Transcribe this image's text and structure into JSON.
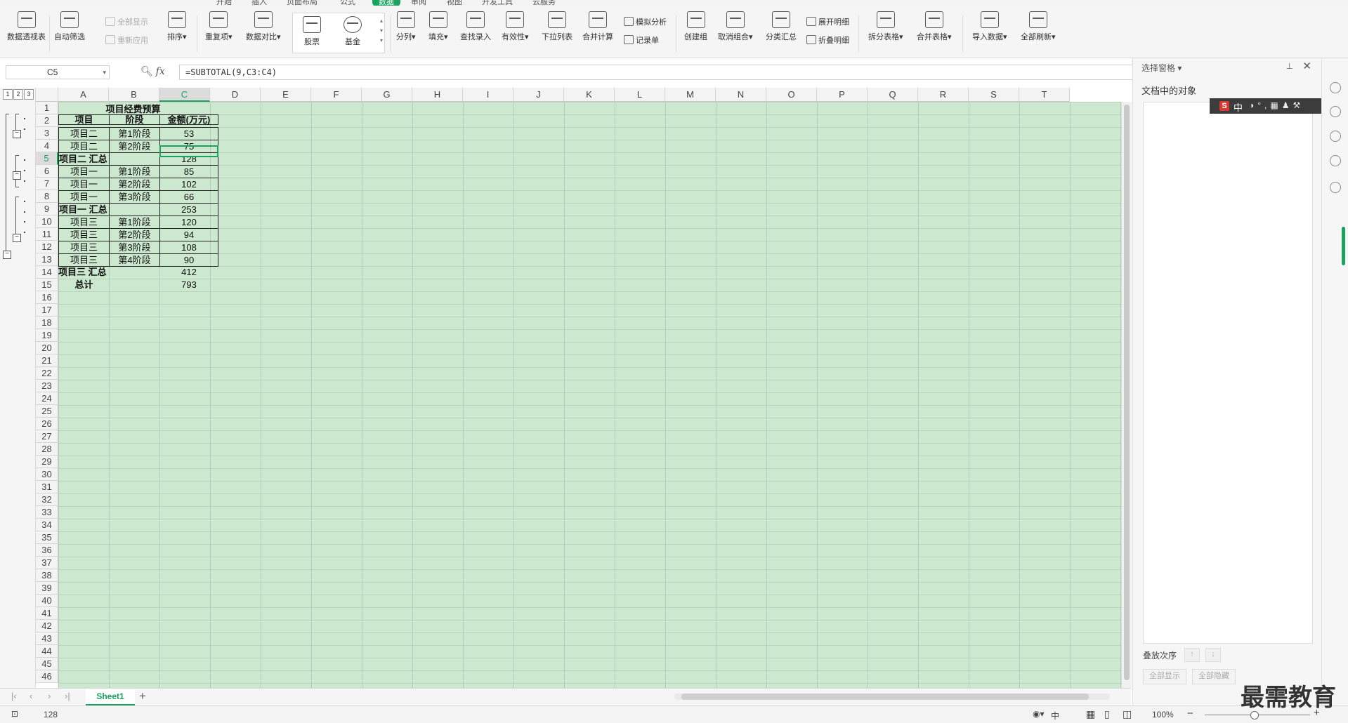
{
  "menu": {
    "tabs": [
      "开始",
      "插入",
      "页面布局",
      "公式",
      "数据",
      "审阅",
      "视图",
      "开发工具",
      "云服务"
    ],
    "active": "数据"
  },
  "ribbon": {
    "pivot": "数据透视表",
    "autofilter": "自动筛选",
    "show_all": "全部显示",
    "reapply": "重新应用",
    "sort": "排序",
    "duplicates": "重复项",
    "compare": "数据对比",
    "stock": "股票",
    "fund": "基金",
    "split": "分列",
    "fill": "填充",
    "lookup": "查找录入",
    "validity": "有效性",
    "dropdown": "下拉列表",
    "consolidate": "合并计算",
    "whatif": "模拟分析",
    "record": "记录单",
    "group": "创建组",
    "ungroup": "取消组合",
    "subtotal": "分类汇总",
    "expand": "展开明细",
    "collapse": "折叠明细",
    "split_table": "拆分表格",
    "merge_table": "合并表格",
    "import": "导入数据",
    "refresh": "全部刷新"
  },
  "formula_bar": {
    "name_box": "C5",
    "fx": "fx",
    "formula": "=SUBTOTAL(9,C3:C4)"
  },
  "columns": [
    "A",
    "B",
    "C",
    "D",
    "E",
    "F",
    "G",
    "H",
    "I",
    "J",
    "K",
    "L",
    "M",
    "N",
    "O",
    "P",
    "Q",
    "R",
    "S",
    "T"
  ],
  "selected_col": "C",
  "rows": [
    "1",
    "2",
    "3",
    "4",
    "5",
    "6",
    "7",
    "8",
    "9",
    "10",
    "11",
    "12",
    "13",
    "14",
    "15",
    "16",
    "17",
    "18",
    "19",
    "20",
    "21",
    "22",
    "23",
    "24",
    "25",
    "26",
    "27",
    "28",
    "29",
    "30",
    "31",
    "32",
    "33",
    "34",
    "35",
    "36",
    "37",
    "38",
    "39",
    "40",
    "41",
    "42",
    "43",
    "44",
    "45",
    "46"
  ],
  "selected_row": "5",
  "outline_levels": [
    "1",
    "2",
    "3"
  ],
  "table": {
    "title": "项目经费预算",
    "headers": [
      "项目",
      "阶段",
      "金额(万元)"
    ],
    "records": [
      {
        "a": "项目二",
        "b": "第1阶段",
        "c": "53"
      },
      {
        "a": "项目二",
        "b": "第2阶段",
        "c": "75"
      },
      {
        "a": "项目二 汇总",
        "b": "",
        "c": "128",
        "summary": true
      },
      {
        "a": "项目一",
        "b": "第1阶段",
        "c": "85"
      },
      {
        "a": "项目一",
        "b": "第2阶段",
        "c": "102"
      },
      {
        "a": "项目一",
        "b": "第3阶段",
        "c": "66"
      },
      {
        "a": "项目一 汇总",
        "b": "",
        "c": "253",
        "summary": true
      },
      {
        "a": "项目三",
        "b": "第1阶段",
        "c": "120"
      },
      {
        "a": "项目三",
        "b": "第2阶段",
        "c": "94"
      },
      {
        "a": "项目三",
        "b": "第3阶段",
        "c": "108"
      },
      {
        "a": "项目三",
        "b": "第4阶段",
        "c": "90"
      },
      {
        "a": "项目三 汇总",
        "b": "",
        "c": "412",
        "summary": true,
        "noborder": true
      },
      {
        "a": "总计",
        "b": "",
        "c": "793",
        "summary": true,
        "noborder": true,
        "center": true
      }
    ]
  },
  "sheet_tab": "Sheet1",
  "status": {
    "value": "128",
    "zoom": "100%",
    "ime_label": "中"
  },
  "pane": {
    "title": "选择窗格",
    "subtitle": "文档中的对象",
    "order_label": "叠放次序",
    "show_all": "全部显示",
    "hide_all": "全部隐藏"
  },
  "ime": {
    "logo": "S",
    "mode": "中",
    "extra": "◑°,▦♟⚒"
  },
  "watermark": "最需教育",
  "colors": {
    "accent": "#1aa260",
    "sheet_bg": "#cce8cf"
  }
}
